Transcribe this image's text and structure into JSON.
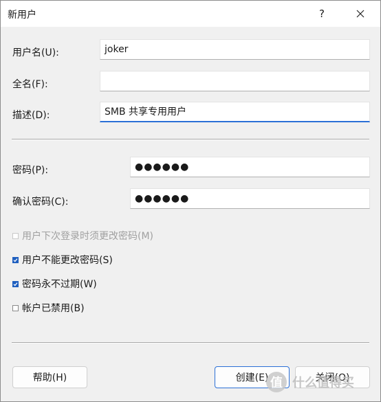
{
  "window": {
    "title": "新用户",
    "help_glyph": "?",
    "close_glyph": "✕"
  },
  "form": {
    "username_label": "用户名(U):",
    "username_value": "joker",
    "fullname_label": "全名(F):",
    "fullname_value": "",
    "description_label": "描述(D):",
    "description_value": "SMB 共享专用用户",
    "password_label": "密码(P):",
    "password_value": "●●●●●●",
    "confirm_label": "确认密码(C):",
    "confirm_value": "●●●●●●"
  },
  "options": [
    {
      "label": "用户下次登录时须更改密码(M)",
      "checked": false,
      "disabled": true
    },
    {
      "label": "用户不能更改密码(S)",
      "checked": true,
      "disabled": false
    },
    {
      "label": "密码永不过期(W)",
      "checked": true,
      "disabled": false
    },
    {
      "label": "帐户已禁用(B)",
      "checked": false,
      "disabled": false
    }
  ],
  "buttons": {
    "help": "帮助(H)",
    "create": "创建(E)",
    "close": "关闭(O)"
  },
  "watermark": {
    "glyph": "值",
    "text": "什么值得买"
  },
  "colors": {
    "accent": "#2a6fd6",
    "checkbox_checked": "#1f5fbf",
    "background": "#f0f0f0"
  }
}
